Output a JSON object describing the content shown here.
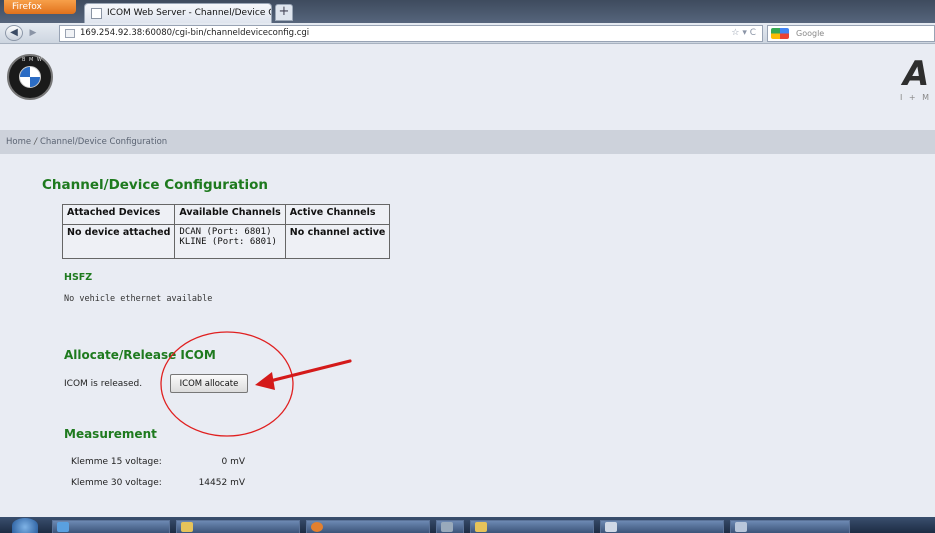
{
  "browser": {
    "menu_label": "Firefox",
    "tab_title": "ICOM Web Server - Channel/Device Con...",
    "new_tab_label": "+",
    "url": "169.254.92.38:60080/cgi-bin/channeldeviceconfig.cgi",
    "url_tools": "☆ ▾ C",
    "search_placeholder": "Google"
  },
  "header": {
    "brand_letter": "A",
    "brand_sub": "I + M"
  },
  "breadcrumb": {
    "home": "Home",
    "sep": "/",
    "current": "Channel/Device Configuration"
  },
  "config": {
    "title": "Channel/Device Configuration",
    "headers": [
      "Attached Devices",
      "Available Channels",
      "Active Channels"
    ],
    "attached": "No device attached",
    "channels": [
      "DCAN (Port: 6801)",
      "KLINE (Port: 6801)"
    ],
    "active": "No channel active"
  },
  "hsfz": {
    "title": "HSFZ",
    "text": "No vehicle ethernet available"
  },
  "allocate": {
    "title": "Allocate/Release ICOM",
    "status": "ICOM is released.",
    "button": "ICOM allocate"
  },
  "measurement": {
    "title": "Measurement",
    "rows": [
      {
        "label": "Klemme 15 voltage:",
        "value": "0 mV"
      },
      {
        "label": "Klemme 30 voltage:",
        "value": "14452 mV"
      }
    ]
  },
  "colors": {
    "heading_green": "#1e7a1e",
    "annotation_red": "#e02020"
  }
}
